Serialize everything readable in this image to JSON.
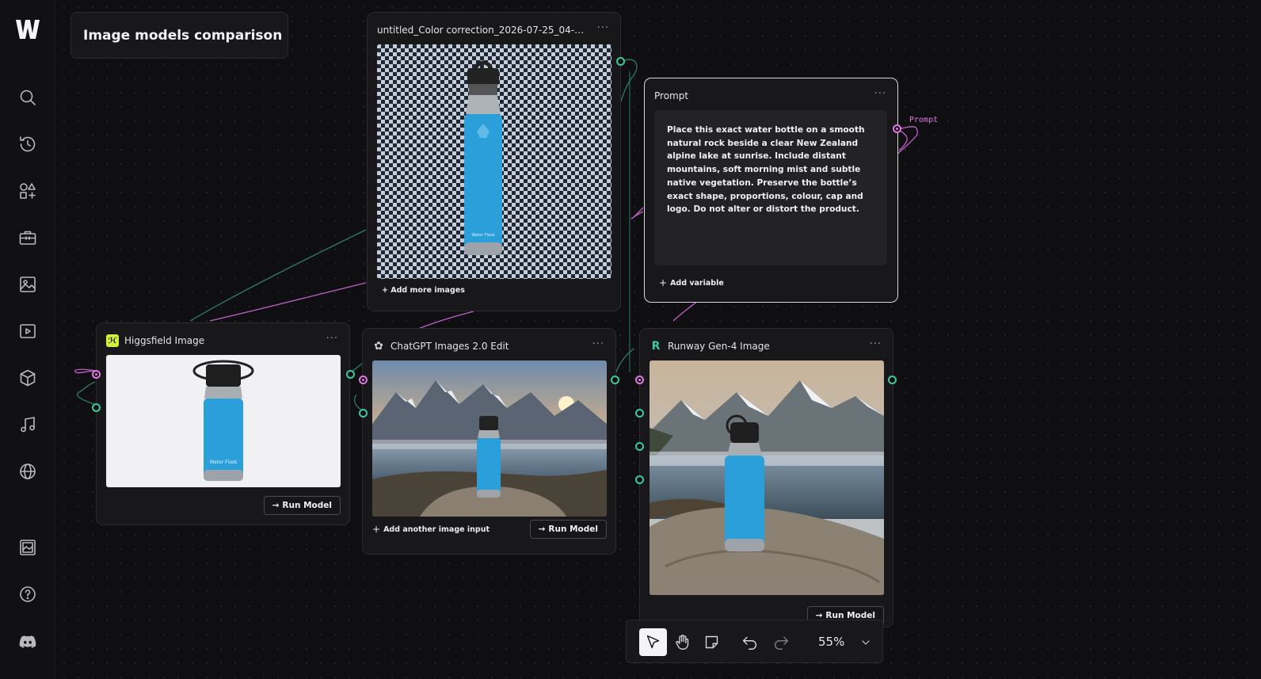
{
  "workflow_title": "Image models comparison",
  "sidebar": {
    "items": [
      "search-icon",
      "history-icon",
      "shapes-plus-icon",
      "toolbox-icon",
      "image-icon",
      "video-icon",
      "cube-icon",
      "music-icon",
      "globe-icon",
      "gallery-icon",
      "help-icon",
      "discord-icon"
    ]
  },
  "nodes": {
    "source": {
      "title": "untitled_Color correction_2026-07-25_04-4...",
      "add_more": "+ Add more images"
    },
    "prompt": {
      "title": "Prompt",
      "text": "Place this exact water bottle on a smooth natural rock beside a clear New Zealand alpine lake at sunrise. Include distant mountains, soft morning mist and subtle native vegetation. Preserve the bottle’s exact shape, proportions, colour, cap and logo. Do not alter or distort the product.",
      "add_variable": "Add variable",
      "port_label": "Prompt"
    },
    "higgsfield": {
      "title": "Higgsfield Image",
      "run": "Run Model"
    },
    "chatgpt": {
      "title": "ChatGPT Images 2.0 Edit",
      "add_input": "Add another image input",
      "run": "Run Model"
    },
    "runway": {
      "title": "Runway Gen-4 Image",
      "run": "Run Model"
    }
  },
  "toolbar": {
    "zoom": "55%",
    "tools": [
      "pointer-icon",
      "hand-icon",
      "sticky-note-icon",
      "undo-icon",
      "redo-icon"
    ]
  },
  "colors": {
    "accent_pink": "#e07ae0",
    "accent_teal": "#3ac9a0",
    "bottle_blue": "#2b9fd9"
  }
}
